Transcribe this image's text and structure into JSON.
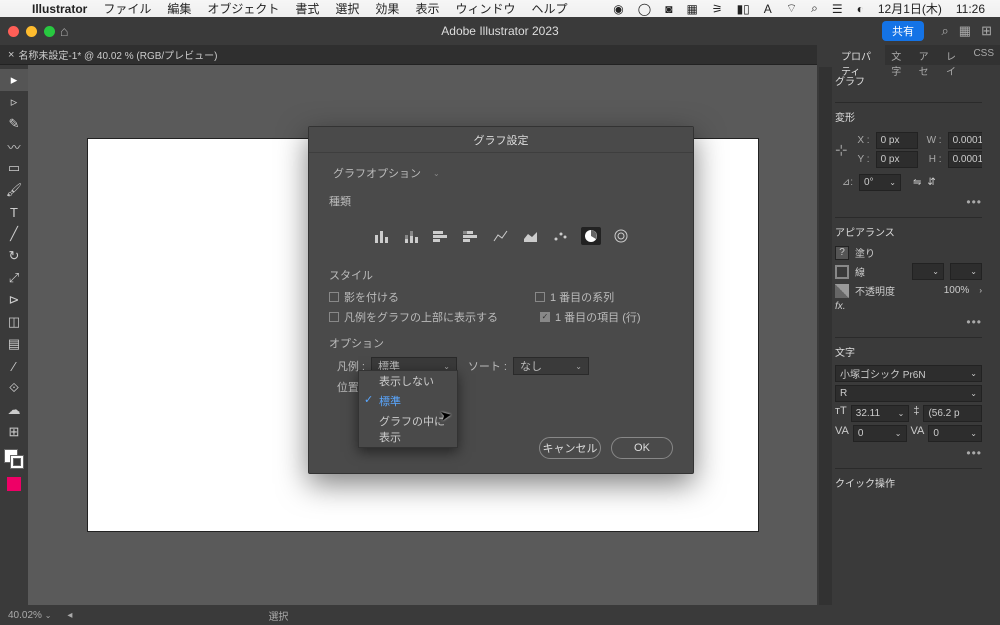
{
  "menubar": {
    "app": "Illustrator",
    "items": [
      "ファイル",
      "編集",
      "オブジェクト",
      "書式",
      "選択",
      "効果",
      "表示",
      "ウィンドウ",
      "ヘルプ"
    ],
    "date": "12月1日(木)",
    "time": "11:26"
  },
  "appbar": {
    "title": "Adobe Illustrator 2023",
    "share": "共有"
  },
  "tab": {
    "label": "名称未設定-1* @ 40.02 % (RGB/プレビュー)"
  },
  "panel": {
    "tabs": [
      "プロパティ",
      "文字",
      "アセ",
      "レイ",
      "CSS"
    ],
    "graph": "グラフ",
    "transform": "変形",
    "x_label": "X :",
    "y_label": "Y :",
    "w_label": "W :",
    "h_label": "H :",
    "x": "0 px",
    "y": "0 px",
    "w": "0.0001",
    "h": "0.0001",
    "angle_label": "⊿:",
    "angle": "0°",
    "appearance": "アピアランス",
    "fill": "塗り",
    "stroke": "線",
    "opacity_label": "不透明度",
    "opacity": "100%",
    "type": "文字",
    "font": "小塚ゴシック Pr6N",
    "font_style": "R",
    "font_size": "32.11",
    "leading": "(56.2 p",
    "tracking": "0",
    "kerning": "0",
    "quick": "クイック操作"
  },
  "dialog": {
    "title": "グラフ設定",
    "graph_option": "グラフオプション",
    "kind": "種類",
    "style": "スタイル",
    "shadow": "影を付ける",
    "first_col": "1 番目の系列",
    "legend_top": "凡例をグラフの上部に表示する",
    "first_row": "1 番目の項目 (行)",
    "options": "オプション",
    "legend_label": "凡例 :",
    "legend_val": "標準",
    "sort_label": "ソート :",
    "sort_val": "なし",
    "pos_label": "位置 :",
    "cancel": "キャンセル",
    "ok": "OK"
  },
  "menu": {
    "none": "表示しない",
    "standard": "標準",
    "inside": "グラフの中に表示"
  },
  "status": {
    "zoom": "40.02%",
    "sel": "選択"
  }
}
